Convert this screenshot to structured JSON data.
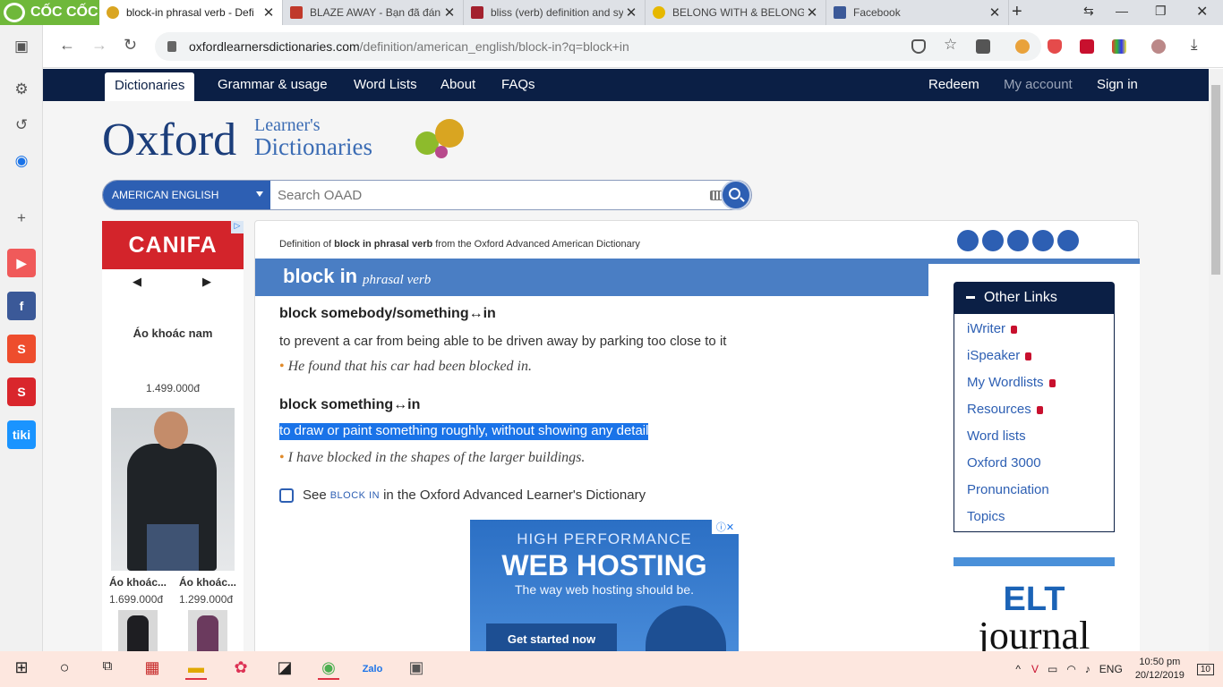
{
  "browser": {
    "brand": "CỐC CỐC",
    "tabs": [
      {
        "title": "block-in phrasal verb - Defi",
        "active": true
      },
      {
        "title": "BLAZE AWAY - Bạn đã đánh"
      },
      {
        "title": "bliss (verb) definition and sy"
      },
      {
        "title": "BELONG WITH & BELONG T"
      },
      {
        "title": "Facebook"
      }
    ],
    "url_host": "oxfordlearnersdictionaries.com",
    "url_path": "/definition/american_english/block-in?q=block+in"
  },
  "site": {
    "nav": [
      "Dictionaries",
      "Grammar & usage",
      "Word Lists",
      "About",
      "FAQs"
    ],
    "right_nav": [
      "Redeem",
      "My account",
      "Sign in"
    ],
    "logo_word": "Oxford",
    "logo_sub1": "Learner's",
    "logo_sub2": "Dictionaries",
    "dictionary_select": "AMERICAN ENGLISH",
    "search_placeholder": "Search OAAD"
  },
  "ad_left": {
    "brand": "CANIFA",
    "title": "Áo khoác nam",
    "price": "1.499.000đ",
    "items": [
      {
        "name": "Áo khoác...",
        "price": "1.699.000đ"
      },
      {
        "name": "Áo khoác...",
        "price": "1.299.000đ"
      }
    ]
  },
  "entry": {
    "def_prefix": "Definition of ",
    "def_word": "block in phrasal verb",
    "def_suffix": " from the Oxford Advanced American Dictionary",
    "headword": "block in",
    "pos": "phrasal verb",
    "senses": [
      {
        "head": "block somebody/something↔in",
        "def": "to prevent a car from being able to be driven away by parking too close to it",
        "example": "He found that his car had been blocked in."
      },
      {
        "head": "block something↔in",
        "def": "to draw or paint something roughly, without showing any detail",
        "example": "I have blocked in the shapes of the larger buildings."
      }
    ],
    "see_pre": "See ",
    "see_link": "BLOCK IN",
    "see_post": " in the Oxford Advanced Learner's Dictionary"
  },
  "ad_center": {
    "line1": "HIGH PERFORMANCE",
    "line2": "WEB HOSTING",
    "line3": "The way web hosting should be.",
    "cta": "Get started now"
  },
  "other_links": {
    "title": "Other Links",
    "items": [
      "iWriter",
      "iSpeaker",
      "My Wordlists",
      "Resources",
      "Word lists",
      "Oxford 3000",
      "Pronunciation",
      "Topics"
    ]
  },
  "elt": {
    "line1": "ELT",
    "line2": "journal"
  },
  "taskbar": {
    "lang": "ENG",
    "time": "10:50 pm",
    "date": "20/12/2019",
    "notif": "10"
  }
}
